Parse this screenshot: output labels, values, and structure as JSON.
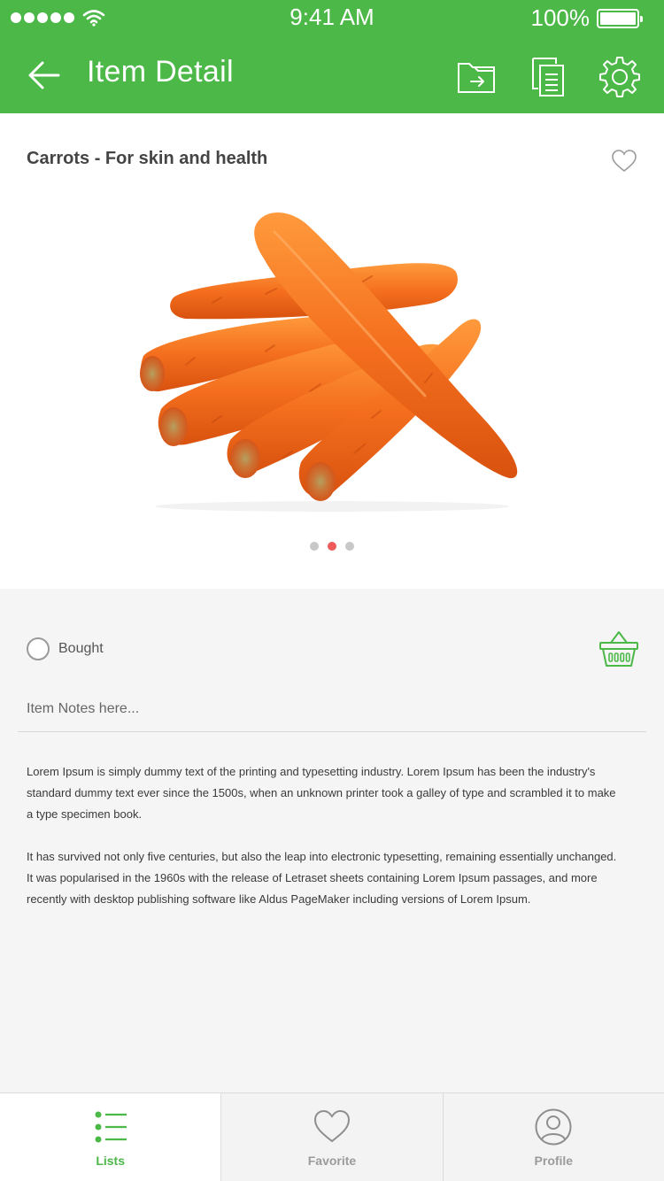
{
  "status_bar": {
    "time": "9:41 AM",
    "battery": "100%"
  },
  "header": {
    "title": "Item Detail"
  },
  "product": {
    "title": "Carrots - For skin and health",
    "image_name": "carrots-photo",
    "pager": {
      "count": 3,
      "active_index": 1
    }
  },
  "details": {
    "bought_label": "Bought",
    "notes_placeholder": "Item Notes here...",
    "description": [
      "Lorem Ipsum is simply dummy text of the printing and typesetting industry. Lorem Ipsum has been the industry's standard dummy text ever since the 1500s, when an unknown printer took a galley of type and scrambled it to make a type specimen book.",
      "It has survived not only five centuries, but also the leap into electronic typesetting, remaining essentially unchanged. It was popularised in the 1960s with the release of Letraset sheets containing Lorem Ipsum passages, and more recently with desktop publishing software like Aldus PageMaker including versions of Lorem Ipsum."
    ]
  },
  "tabbar": {
    "tabs": [
      {
        "label": "Lists",
        "icon": "list-icon",
        "active": true
      },
      {
        "label": "Favorite",
        "icon": "heart-icon",
        "active": false
      },
      {
        "label": "Profile",
        "icon": "profile-icon",
        "active": false
      }
    ]
  },
  "colors": {
    "brand_green": "#4cb848",
    "pager_active": "#ee5a5a",
    "carrot_orange": "#f26a1b"
  }
}
